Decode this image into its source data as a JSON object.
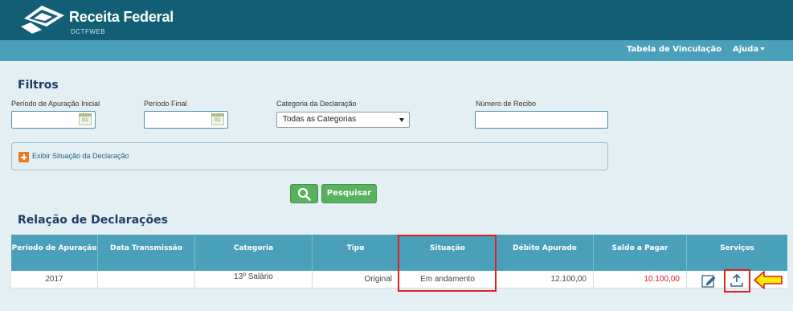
{
  "header": {
    "brand": "Receita Federal",
    "subtitle": "DCTFWEB",
    "logo_icon": "receita-federal-logo"
  },
  "nav": {
    "tabela_vinculacao": "Tabela de Vinculação",
    "ajuda": "Ajuda"
  },
  "filters": {
    "title": "Filtros",
    "periodo_inicial_label": "Período de Apuração Inicial",
    "periodo_inicial_value": "",
    "periodo_final_label": "Período Final",
    "periodo_final_value": "",
    "categoria_label": "Categoria da Declaração",
    "categoria_value": "Todas as Categorias",
    "recibo_label": "Número de Recibo",
    "recibo_value": "",
    "calendar_day": "01",
    "exibir_situacao": "Exibir Situação da Declaração",
    "search_icon": "search-icon",
    "pesquisar": "Pesquisar"
  },
  "results": {
    "title": "Relação de Declarações",
    "columns": {
      "periodo": "Período de Apuração",
      "data_transmissao": "Data Transmissão",
      "categoria": "Categoria",
      "tipo": "Tipo",
      "situacao": "Situação",
      "debito": "Débito Apurado",
      "saldo": "Saldo a Pagar",
      "servicos": "Serviços"
    },
    "rows": [
      {
        "periodo": "2017",
        "data_transmissao": "",
        "categoria": "13º Salário",
        "tipo": "Original",
        "situacao": "Em andamento",
        "debito": "12.100,00",
        "saldo": "10.100,00",
        "services_icons": [
          "edit-icon",
          "upload-icon"
        ]
      }
    ]
  },
  "colors": {
    "header_bg": "#125e74",
    "nav_bg": "#4ba0b9",
    "page_bg": "#e4eff3",
    "title": "#1d3f66",
    "button_green": "#58b15c",
    "saldo_red": "#e0202a",
    "highlight_red": "#e02020",
    "arrow_yellow": "#ffeb00"
  }
}
